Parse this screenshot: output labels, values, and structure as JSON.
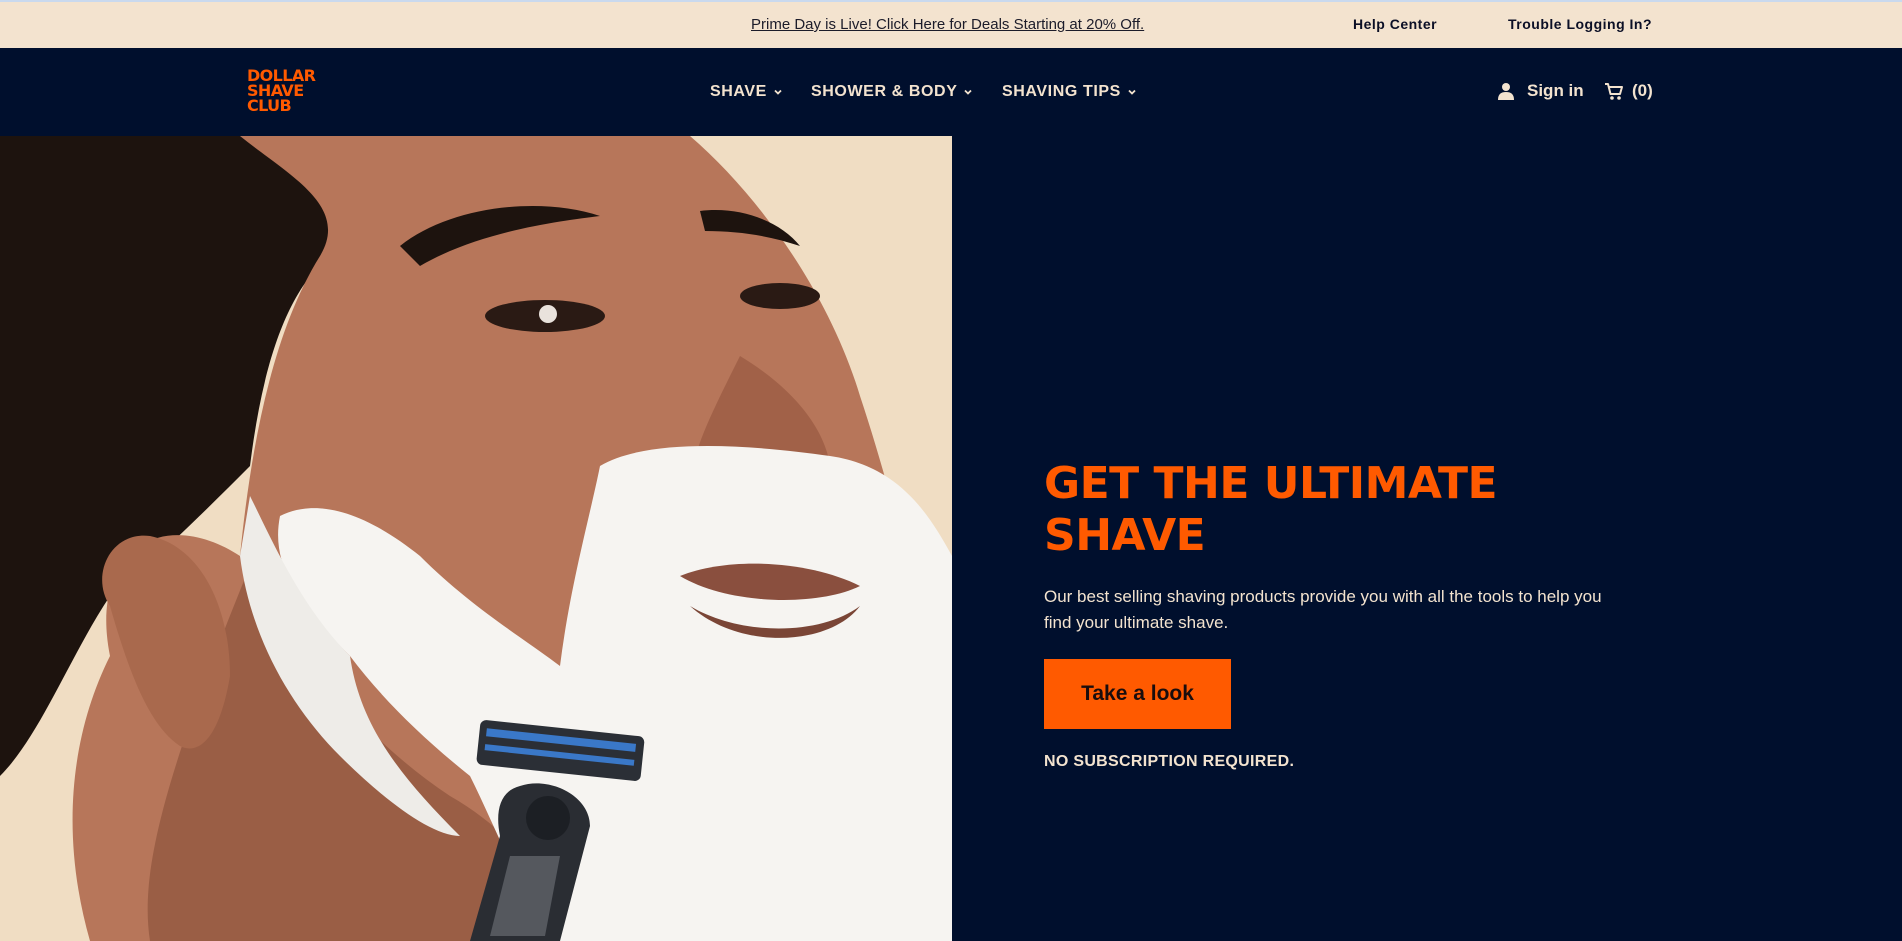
{
  "promo_bar": {
    "deal_text": "Prime Day is Live! Click Here for Deals Starting at 20% Off.",
    "help_center": "Help Center",
    "trouble_login": "Trouble Logging In?"
  },
  "brand": {
    "logo_lines": [
      "DOLLAR",
      "SHAVE",
      "CLUB"
    ],
    "accent_color": "#ff5a00",
    "navy_color": "#000f2d",
    "cream_color": "#f3e3cf"
  },
  "nav": {
    "items": [
      {
        "label": "SHAVE",
        "icon": "chevron-down-icon"
      },
      {
        "label": "SHOWER & BODY",
        "icon": "chevron-down-icon"
      },
      {
        "label": "SHAVING TIPS",
        "icon": "chevron-down-icon"
      }
    ],
    "sign_in": "Sign in",
    "cart_count": "(0)"
  },
  "hero": {
    "title_line1": "GET THE ULTIMATE",
    "title_line2": "SHAVE",
    "description": "Our best selling shaving products provide you with all the tools to help you find your ultimate shave.",
    "cta_label": "Take a look",
    "note": "NO SUBSCRIPTION REQUIRED."
  }
}
